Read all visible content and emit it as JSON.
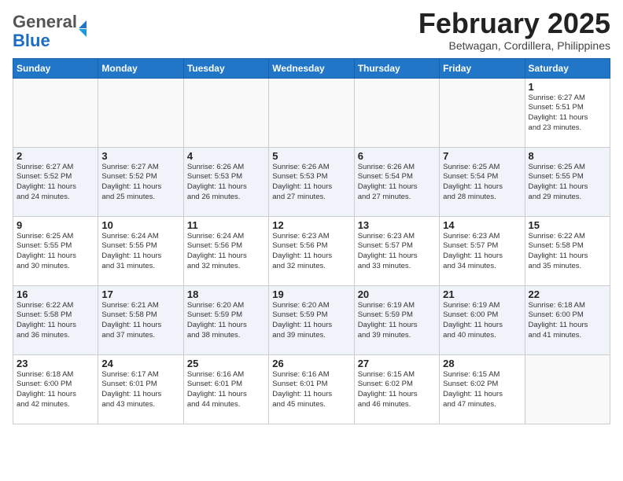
{
  "header": {
    "logo_general": "General",
    "logo_blue": "Blue",
    "month_title": "February 2025",
    "location": "Betwagan, Cordillera, Philippines"
  },
  "days_of_week": [
    "Sunday",
    "Monday",
    "Tuesday",
    "Wednesday",
    "Thursday",
    "Friday",
    "Saturday"
  ],
  "weeks": [
    [
      {
        "day": "",
        "info": ""
      },
      {
        "day": "",
        "info": ""
      },
      {
        "day": "",
        "info": ""
      },
      {
        "day": "",
        "info": ""
      },
      {
        "day": "",
        "info": ""
      },
      {
        "day": "",
        "info": ""
      },
      {
        "day": "1",
        "info": "Sunrise: 6:27 AM\nSunset: 5:51 PM\nDaylight: 11 hours\nand 23 minutes."
      }
    ],
    [
      {
        "day": "2",
        "info": "Sunrise: 6:27 AM\nSunset: 5:52 PM\nDaylight: 11 hours\nand 24 minutes."
      },
      {
        "day": "3",
        "info": "Sunrise: 6:27 AM\nSunset: 5:52 PM\nDaylight: 11 hours\nand 25 minutes."
      },
      {
        "day": "4",
        "info": "Sunrise: 6:26 AM\nSunset: 5:53 PM\nDaylight: 11 hours\nand 26 minutes."
      },
      {
        "day": "5",
        "info": "Sunrise: 6:26 AM\nSunset: 5:53 PM\nDaylight: 11 hours\nand 27 minutes."
      },
      {
        "day": "6",
        "info": "Sunrise: 6:26 AM\nSunset: 5:54 PM\nDaylight: 11 hours\nand 27 minutes."
      },
      {
        "day": "7",
        "info": "Sunrise: 6:25 AM\nSunset: 5:54 PM\nDaylight: 11 hours\nand 28 minutes."
      },
      {
        "day": "8",
        "info": "Sunrise: 6:25 AM\nSunset: 5:55 PM\nDaylight: 11 hours\nand 29 minutes."
      }
    ],
    [
      {
        "day": "9",
        "info": "Sunrise: 6:25 AM\nSunset: 5:55 PM\nDaylight: 11 hours\nand 30 minutes."
      },
      {
        "day": "10",
        "info": "Sunrise: 6:24 AM\nSunset: 5:55 PM\nDaylight: 11 hours\nand 31 minutes."
      },
      {
        "day": "11",
        "info": "Sunrise: 6:24 AM\nSunset: 5:56 PM\nDaylight: 11 hours\nand 32 minutes."
      },
      {
        "day": "12",
        "info": "Sunrise: 6:23 AM\nSunset: 5:56 PM\nDaylight: 11 hours\nand 32 minutes."
      },
      {
        "day": "13",
        "info": "Sunrise: 6:23 AM\nSunset: 5:57 PM\nDaylight: 11 hours\nand 33 minutes."
      },
      {
        "day": "14",
        "info": "Sunrise: 6:23 AM\nSunset: 5:57 PM\nDaylight: 11 hours\nand 34 minutes."
      },
      {
        "day": "15",
        "info": "Sunrise: 6:22 AM\nSunset: 5:58 PM\nDaylight: 11 hours\nand 35 minutes."
      }
    ],
    [
      {
        "day": "16",
        "info": "Sunrise: 6:22 AM\nSunset: 5:58 PM\nDaylight: 11 hours\nand 36 minutes."
      },
      {
        "day": "17",
        "info": "Sunrise: 6:21 AM\nSunset: 5:58 PM\nDaylight: 11 hours\nand 37 minutes."
      },
      {
        "day": "18",
        "info": "Sunrise: 6:20 AM\nSunset: 5:59 PM\nDaylight: 11 hours\nand 38 minutes."
      },
      {
        "day": "19",
        "info": "Sunrise: 6:20 AM\nSunset: 5:59 PM\nDaylight: 11 hours\nand 39 minutes."
      },
      {
        "day": "20",
        "info": "Sunrise: 6:19 AM\nSunset: 5:59 PM\nDaylight: 11 hours\nand 39 minutes."
      },
      {
        "day": "21",
        "info": "Sunrise: 6:19 AM\nSunset: 6:00 PM\nDaylight: 11 hours\nand 40 minutes."
      },
      {
        "day": "22",
        "info": "Sunrise: 6:18 AM\nSunset: 6:00 PM\nDaylight: 11 hours\nand 41 minutes."
      }
    ],
    [
      {
        "day": "23",
        "info": "Sunrise: 6:18 AM\nSunset: 6:00 PM\nDaylight: 11 hours\nand 42 minutes."
      },
      {
        "day": "24",
        "info": "Sunrise: 6:17 AM\nSunset: 6:01 PM\nDaylight: 11 hours\nand 43 minutes."
      },
      {
        "day": "25",
        "info": "Sunrise: 6:16 AM\nSunset: 6:01 PM\nDaylight: 11 hours\nand 44 minutes."
      },
      {
        "day": "26",
        "info": "Sunrise: 6:16 AM\nSunset: 6:01 PM\nDaylight: 11 hours\nand 45 minutes."
      },
      {
        "day": "27",
        "info": "Sunrise: 6:15 AM\nSunset: 6:02 PM\nDaylight: 11 hours\nand 46 minutes."
      },
      {
        "day": "28",
        "info": "Sunrise: 6:15 AM\nSunset: 6:02 PM\nDaylight: 11 hours\nand 47 minutes."
      },
      {
        "day": "",
        "info": ""
      }
    ]
  ]
}
